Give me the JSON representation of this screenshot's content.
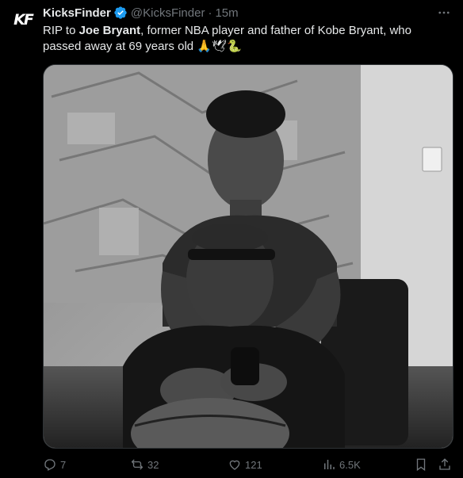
{
  "tweet": {
    "author_name": "KicksFinder",
    "handle": "@KicksFinder",
    "separator": "·",
    "time": "15m",
    "avatar_text": "KF",
    "verified": true,
    "text_prefix": "RIP to ",
    "text_bold": "Joe Bryant",
    "text_rest": ", former NBA player and father of Kobe Bryant, who passed away at 69 years old",
    "emoji": "🙏🕊🐍"
  },
  "actions": {
    "replies": "7",
    "reposts": "32",
    "likes": "121",
    "views": "6.5K"
  },
  "colors": {
    "background": "#000000",
    "text": "#e7e9ea",
    "muted": "#71767b",
    "verified": "#1d9bf0"
  },
  "icons": [
    "more-icon",
    "verified-badge-icon",
    "reply-icon",
    "repost-icon",
    "like-icon",
    "views-icon",
    "bookmark-icon",
    "share-icon"
  ]
}
